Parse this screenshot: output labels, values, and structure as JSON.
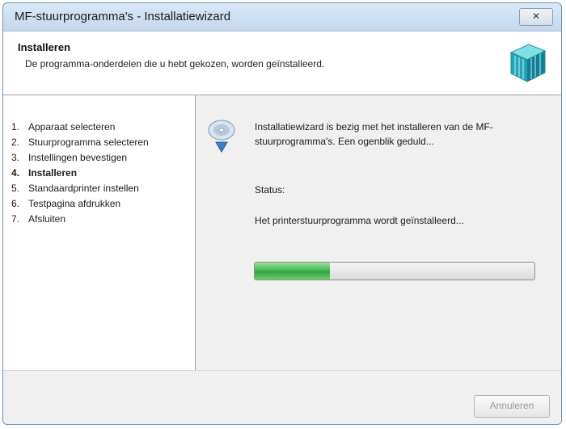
{
  "window": {
    "title": "MF-stuurprogramma's - Installatiewizard",
    "close_label": "✕"
  },
  "header": {
    "title": "Installeren",
    "subtitle": "De programma-onderdelen die u hebt gekozen, worden geïnstalleerd.",
    "icon": "installer-cube-icon"
  },
  "steps": [
    {
      "num": "1.",
      "label": "Apparaat selecteren",
      "active": false
    },
    {
      "num": "2.",
      "label": "Stuurprogramma selecteren",
      "active": false
    },
    {
      "num": "3.",
      "label": "Instellingen bevestigen",
      "active": false
    },
    {
      "num": "4.",
      "label": "Installeren",
      "active": true
    },
    {
      "num": "5.",
      "label": "Standaardprinter instellen",
      "active": false
    },
    {
      "num": "6.",
      "label": "Testpagina afdrukken",
      "active": false
    },
    {
      "num": "7.",
      "label": "Afsluiten",
      "active": false
    }
  ],
  "content": {
    "icon": "install-disc-icon",
    "message": "Installatiewizard is bezig met het installeren van de MF-stuurprogramma's. Een ogenblik geduld...",
    "status_label": "Status:",
    "status_text": "Het printerstuurprogramma wordt geïnstalleerd...",
    "progress_fraction": 0.27,
    "progress_color": "#3fb34f"
  },
  "footer": {
    "cancel_label": "Annuleren"
  }
}
